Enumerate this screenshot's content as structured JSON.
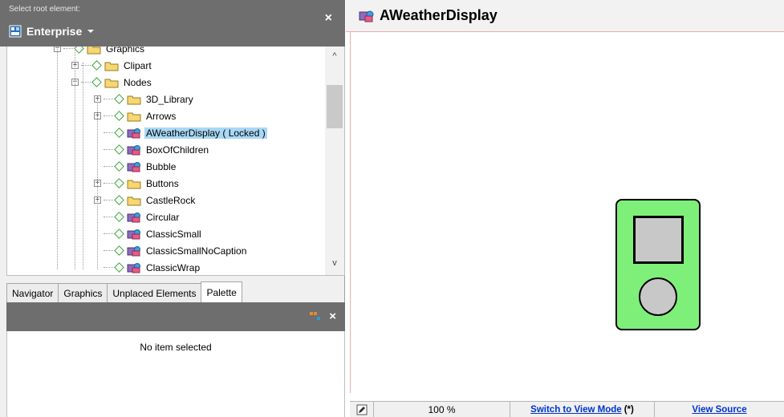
{
  "root_selector": {
    "caption": "Select root element:",
    "value": "Enterprise",
    "close_glyph": "×"
  },
  "tree": {
    "partial_top_item": "Graphics",
    "items": [
      {
        "label": "Clipart",
        "expander": "+",
        "icon": "folder-icon"
      },
      {
        "label": "Nodes",
        "expander": "−",
        "icon": "folder-icon"
      },
      {
        "label": "3D_Library",
        "expander": "+",
        "icon": "folder-icon"
      },
      {
        "label": "Arrows",
        "expander": "+",
        "icon": "folder-icon"
      },
      {
        "label": "AWeatherDisplay ( Locked )",
        "expander": "",
        "icon": "graphic-icon",
        "selected": true
      },
      {
        "label": "BoxOfChildren",
        "expander": "",
        "icon": "graphic-icon"
      },
      {
        "label": "Bubble",
        "expander": "",
        "icon": "graphic-icon"
      },
      {
        "label": "Buttons",
        "expander": "+",
        "icon": "folder-icon"
      },
      {
        "label": "CastleRock",
        "expander": "+",
        "icon": "folder-icon"
      },
      {
        "label": "Circular",
        "expander": "",
        "icon": "graphic-icon"
      },
      {
        "label": "ClassicSmall",
        "expander": "",
        "icon": "graphic-icon"
      },
      {
        "label": "ClassicSmallNoCaption",
        "expander": "",
        "icon": "graphic-icon"
      },
      {
        "label": "ClassicWrap",
        "expander": "",
        "icon": "graphic-icon"
      }
    ]
  },
  "tabs": [
    {
      "label": "Navigator",
      "active": false
    },
    {
      "label": "Graphics",
      "active": false
    },
    {
      "label": "Unplaced Elements",
      "active": false
    },
    {
      "label": "Palette",
      "active": true
    }
  ],
  "palette": {
    "empty_text": "No item selected",
    "close_glyph": "×"
  },
  "editor": {
    "title": "AWeatherDisplay",
    "colors": {
      "device_fill": "#7ef07a",
      "screen_fill": "#c8c8c8"
    }
  },
  "status_bar": {
    "zoom": "100 %",
    "switch_link": "Switch to View Mode",
    "switch_suffix": "(*)",
    "source_link": "View Source"
  }
}
